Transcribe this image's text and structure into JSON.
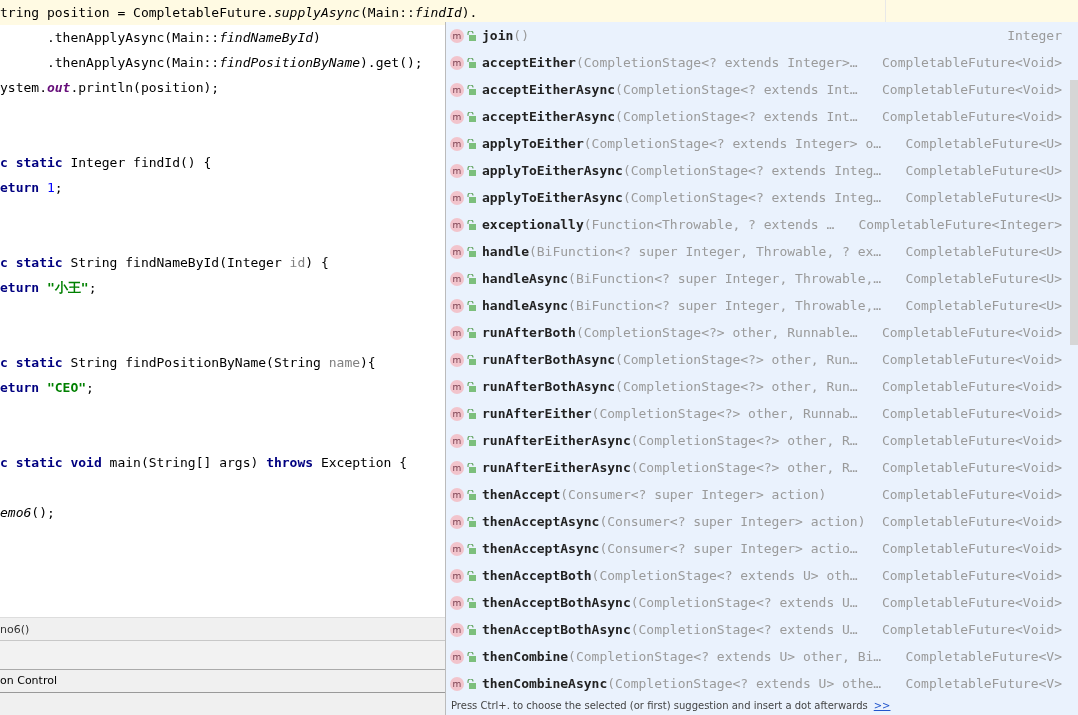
{
  "editor": {
    "lines": [
      {
        "current": true,
        "kind": "code",
        "tokens": [
          {
            "kind": "plain",
            "text": "tring position = CompletableFuture."
          },
          {
            "kind": "italic",
            "text": "supplyAsync"
          },
          {
            "kind": "plain",
            "text": "(Main::"
          },
          {
            "kind": "italic",
            "text": "findId"
          },
          {
            "kind": "plain",
            "text": ")."
          }
        ]
      },
      {
        "current": false,
        "kind": "code",
        "tokens": [
          {
            "kind": "plain",
            "text": "      .thenApplyAsync(Main::"
          },
          {
            "kind": "italic",
            "text": "findNameById"
          },
          {
            "kind": "plain",
            "text": ")"
          }
        ]
      },
      {
        "current": false,
        "kind": "code",
        "tokens": [
          {
            "kind": "plain",
            "text": "      .thenApplyAsync(Main::"
          },
          {
            "kind": "italic",
            "text": "findPositionByName"
          },
          {
            "kind": "plain",
            "text": ").get();"
          }
        ]
      },
      {
        "current": false,
        "kind": "code",
        "tokens": [
          {
            "kind": "plain",
            "text": "ystem."
          },
          {
            "kind": "field",
            "text": "out"
          },
          {
            "kind": "plain",
            "text": ".println(position);"
          }
        ]
      },
      {
        "current": false,
        "kind": "blank"
      },
      {
        "current": false,
        "kind": "blank"
      },
      {
        "current": false,
        "kind": "code",
        "tokens": [
          {
            "kind": "keyword",
            "text": "c static "
          },
          {
            "kind": "plain",
            "text": "Integer findId() {"
          }
        ]
      },
      {
        "current": false,
        "kind": "code",
        "tokens": [
          {
            "kind": "keyword",
            "text": "eturn "
          },
          {
            "kind": "number",
            "text": "1"
          },
          {
            "kind": "plain",
            "text": ";"
          }
        ]
      },
      {
        "current": false,
        "kind": "blank"
      },
      {
        "current": false,
        "kind": "blank"
      },
      {
        "current": false,
        "kind": "code",
        "tokens": [
          {
            "kind": "keyword",
            "text": "c static "
          },
          {
            "kind": "plain",
            "text": "String findNameById(Integer "
          },
          {
            "kind": "unused",
            "text": "id"
          },
          {
            "kind": "plain",
            "text": ") {"
          }
        ]
      },
      {
        "current": false,
        "kind": "code",
        "tokens": [
          {
            "kind": "keyword",
            "text": "eturn "
          },
          {
            "kind": "string",
            "text": "\"小王\""
          },
          {
            "kind": "plain",
            "text": ";"
          }
        ]
      },
      {
        "current": false,
        "kind": "blank"
      },
      {
        "current": false,
        "kind": "blank"
      },
      {
        "current": false,
        "kind": "code",
        "tokens": [
          {
            "kind": "keyword",
            "text": "c static "
          },
          {
            "kind": "plain",
            "text": "String findPositionByName(String "
          },
          {
            "kind": "unused",
            "text": "name"
          },
          {
            "kind": "plain",
            "text": "){"
          }
        ]
      },
      {
        "current": false,
        "kind": "code",
        "tokens": [
          {
            "kind": "keyword",
            "text": "eturn "
          },
          {
            "kind": "string",
            "text": "\"CEO\""
          },
          {
            "kind": "plain",
            "text": ";"
          }
        ]
      },
      {
        "current": false,
        "kind": "blank"
      },
      {
        "current": false,
        "kind": "blank"
      },
      {
        "current": false,
        "kind": "code",
        "tokens": [
          {
            "kind": "keyword",
            "text": "c static void "
          },
          {
            "kind": "plain",
            "text": "main(String[] args) "
          },
          {
            "kind": "keyword",
            "text": "throws "
          },
          {
            "kind": "plain",
            "text": "Exception {"
          }
        ]
      },
      {
        "current": false,
        "kind": "blank"
      },
      {
        "current": false,
        "kind": "code",
        "tokens": [
          {
            "kind": "italic",
            "text": "emo6"
          },
          {
            "kind": "plain",
            "text": "();"
          }
        ]
      }
    ]
  },
  "breadcrumb": "no6()",
  "tool_window_bar": "on Control",
  "completion": {
    "items": [
      {
        "icon": "m",
        "name": "join",
        "params": "()",
        "return_type": "Integer"
      },
      {
        "icon": "m",
        "name": "acceptEither",
        "params": "(CompletionStage<? extends Integer>…",
        "return_type": "CompletableFuture<Void>"
      },
      {
        "icon": "m",
        "name": "acceptEitherAsync",
        "params": "(CompletionStage<? extends Int…",
        "return_type": "CompletableFuture<Void>"
      },
      {
        "icon": "m",
        "name": "acceptEitherAsync",
        "params": "(CompletionStage<? extends Int…",
        "return_type": "CompletableFuture<Void>"
      },
      {
        "icon": "m",
        "name": "applyToEither",
        "params": "(CompletionStage<? extends Integer> o…",
        "return_type": "CompletableFuture<U>"
      },
      {
        "icon": "m",
        "name": "applyToEitherAsync",
        "params": "(CompletionStage<? extends Integ…",
        "return_type": "CompletableFuture<U>"
      },
      {
        "icon": "m",
        "name": "applyToEitherAsync",
        "params": "(CompletionStage<? extends Integ…",
        "return_type": "CompletableFuture<U>"
      },
      {
        "icon": "m",
        "name": "exceptionally",
        "params": "(Function<Throwable, ? extends …",
        "return_type": "CompletableFuture<Integer>"
      },
      {
        "icon": "m",
        "name": "handle",
        "params": "(BiFunction<? super Integer, Throwable, ? ex…",
        "return_type": "CompletableFuture<U>"
      },
      {
        "icon": "m",
        "name": "handleAsync",
        "params": "(BiFunction<? super Integer, Throwable,…",
        "return_type": "CompletableFuture<U>"
      },
      {
        "icon": "m",
        "name": "handleAsync",
        "params": "(BiFunction<? super Integer, Throwable,…",
        "return_type": "CompletableFuture<U>"
      },
      {
        "icon": "m",
        "name": "runAfterBoth",
        "params": "(CompletionStage<?> other, Runnable…",
        "return_type": "CompletableFuture<Void>"
      },
      {
        "icon": "m",
        "name": "runAfterBothAsync",
        "params": "(CompletionStage<?> other, Run…",
        "return_type": "CompletableFuture<Void>"
      },
      {
        "icon": "m",
        "name": "runAfterBothAsync",
        "params": "(CompletionStage<?> other, Run…",
        "return_type": "CompletableFuture<Void>"
      },
      {
        "icon": "m",
        "name": "runAfterEither",
        "params": "(CompletionStage<?> other, Runnab…",
        "return_type": "CompletableFuture<Void>"
      },
      {
        "icon": "m",
        "name": "runAfterEitherAsync",
        "params": "(CompletionStage<?> other, R…",
        "return_type": "CompletableFuture<Void>"
      },
      {
        "icon": "m",
        "name": "runAfterEitherAsync",
        "params": "(CompletionStage<?> other, R…",
        "return_type": "CompletableFuture<Void>"
      },
      {
        "icon": "m",
        "name": "thenAccept",
        "params": "(Consumer<? super Integer> action)",
        "return_type": "CompletableFuture<Void>"
      },
      {
        "icon": "m",
        "name": "thenAcceptAsync",
        "params": "(Consumer<? super Integer> action)",
        "return_type": "CompletableFuture<Void>"
      },
      {
        "icon": "m",
        "name": "thenAcceptAsync",
        "params": "(Consumer<? super Integer> actio…",
        "return_type": "CompletableFuture<Void>"
      },
      {
        "icon": "m",
        "name": "thenAcceptBoth",
        "params": "(CompletionStage<? extends U> oth…",
        "return_type": "CompletableFuture<Void>"
      },
      {
        "icon": "m",
        "name": "thenAcceptBothAsync",
        "params": "(CompletionStage<? extends U…",
        "return_type": "CompletableFuture<Void>"
      },
      {
        "icon": "m",
        "name": "thenAcceptBothAsync",
        "params": "(CompletionStage<? extends U…",
        "return_type": "CompletableFuture<Void>"
      },
      {
        "icon": "m",
        "name": "thenCombine",
        "params": "(CompletionStage<? extends U> other, Bi…",
        "return_type": "CompletableFuture<V>"
      },
      {
        "icon": "m",
        "name": "thenCombineAsync",
        "params": "(CompletionStage<? extends U> othe…",
        "return_type": "CompletableFuture<V>"
      }
    ],
    "hint": "Press Ctrl+. to choose the selected (or first) suggestion and insert a dot afterwards",
    "hint_link": ">>"
  }
}
